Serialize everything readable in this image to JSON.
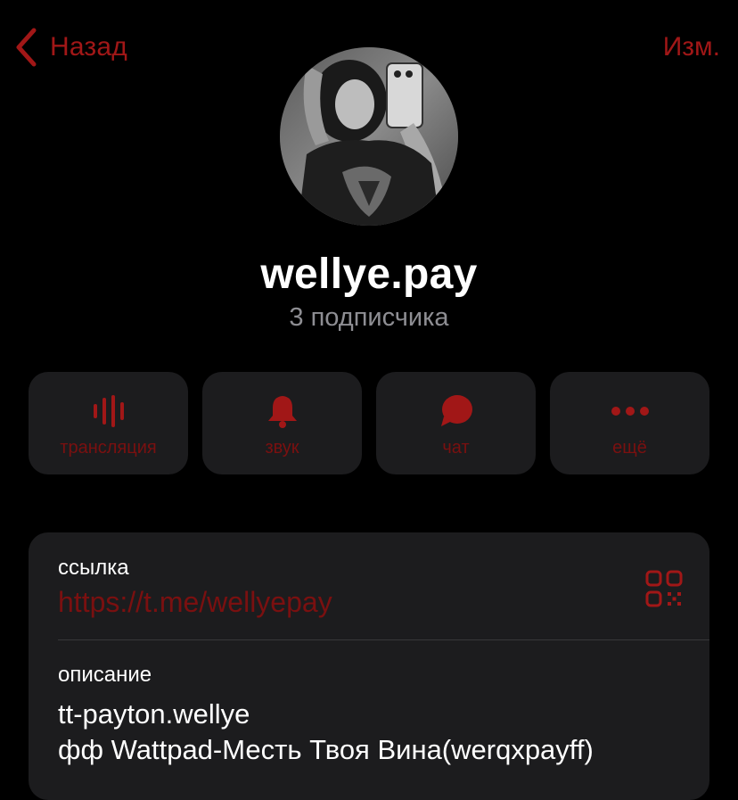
{
  "nav": {
    "back_label": "Назад",
    "edit_label": "Изм."
  },
  "profile": {
    "name": "wellye.pay",
    "subscribers": "3 подписчика"
  },
  "actions": [
    {
      "label": "трансляция",
      "icon": "waveform-icon"
    },
    {
      "label": "звук",
      "icon": "bell-icon"
    },
    {
      "label": "чат",
      "icon": "chat-bubble-icon"
    },
    {
      "label": "ещё",
      "icon": "more-dots-icon"
    }
  ],
  "info": {
    "link_caption": "ссылка",
    "link_value": "https://t.me/wellyepay",
    "description_caption": "описание",
    "description_lines": [
      "tt-payton.wellye",
      "фф Wattpad-Месть Твоя Вина(werqxpayff)"
    ]
  },
  "colors": {
    "background": "#000000",
    "card": "#1c1c1e",
    "accent": "#a11717",
    "accent_dim": "#7a1010",
    "secondary_text": "#8e8e93"
  }
}
